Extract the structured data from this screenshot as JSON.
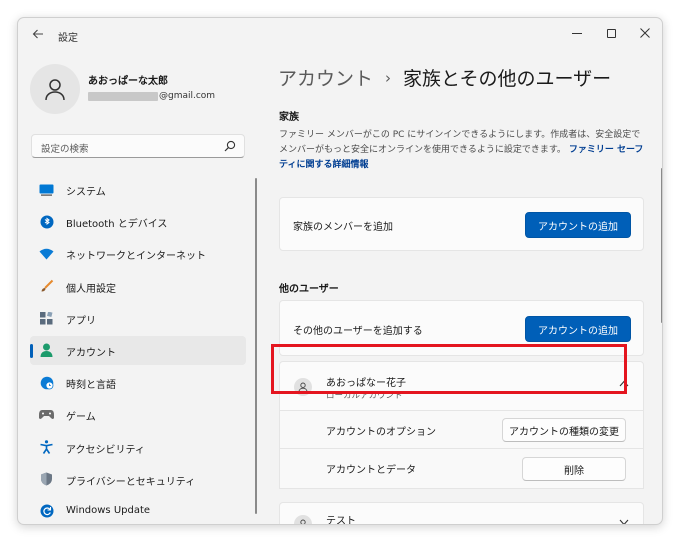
{
  "window": {
    "title": "設定"
  },
  "profile": {
    "name": "あおっぱーな太郎",
    "email_suffix": "@gmail.com"
  },
  "search": {
    "placeholder": "設定の検索"
  },
  "sidebar": {
    "items": [
      {
        "label": "システム",
        "icon": "system-icon",
        "color": "#0078d4"
      },
      {
        "label": "Bluetooth とデバイス",
        "icon": "bluetooth-icon",
        "color": "#0067c0"
      },
      {
        "label": "ネットワークとインターネット",
        "icon": "wifi-icon",
        "color": "#0a7bd5"
      },
      {
        "label": "個人用設定",
        "icon": "brush-icon",
        "color": "#e68a2e"
      },
      {
        "label": "アプリ",
        "icon": "apps-icon",
        "color": "#5a6b7d"
      },
      {
        "label": "アカウント",
        "icon": "account-icon",
        "color": "#1c9a6b",
        "selected": true
      },
      {
        "label": "時刻と言語",
        "icon": "globe-clock-icon",
        "color": "#0a7bd5"
      },
      {
        "label": "ゲーム",
        "icon": "gamepad-icon",
        "color": "#6b6b6b"
      },
      {
        "label": "アクセシビリティ",
        "icon": "accessibility-icon",
        "color": "#0067c0"
      },
      {
        "label": "プライバシーとセキュリティ",
        "icon": "shield-icon",
        "color": "#6b7785"
      },
      {
        "label": "Windows Update",
        "icon": "update-icon",
        "color": "#0067c0"
      }
    ]
  },
  "breadcrumb": {
    "parent": "アカウント",
    "separator": "›",
    "current": "家族とその他のユーザー"
  },
  "family": {
    "title": "家族",
    "description": "ファミリー メンバーがこの PC にサインインできるようにします。作成者は、安全設定でメンバーがもっと安全にオンラインを使用できるように設定できます。",
    "link": "ファミリー セーフティに関する詳細情報",
    "add_label": "家族のメンバーを追加",
    "add_button": "アカウントの追加"
  },
  "other_users": {
    "title": "他のユーザー",
    "add_label": "その他のユーザーを追加する",
    "add_button": "アカウントの追加",
    "users": [
      {
        "name": "あおっぱなー花子",
        "type": "ローカルアカウント",
        "expanded": true,
        "options_label": "アカウントのオプション",
        "options_button": "アカウントの種類の変更",
        "data_label": "アカウントとデータ",
        "data_button": "削除"
      },
      {
        "name": "テスト",
        "expanded": false
      }
    ]
  },
  "accent_color": "#005fb8",
  "highlight_color": "#e4151f"
}
